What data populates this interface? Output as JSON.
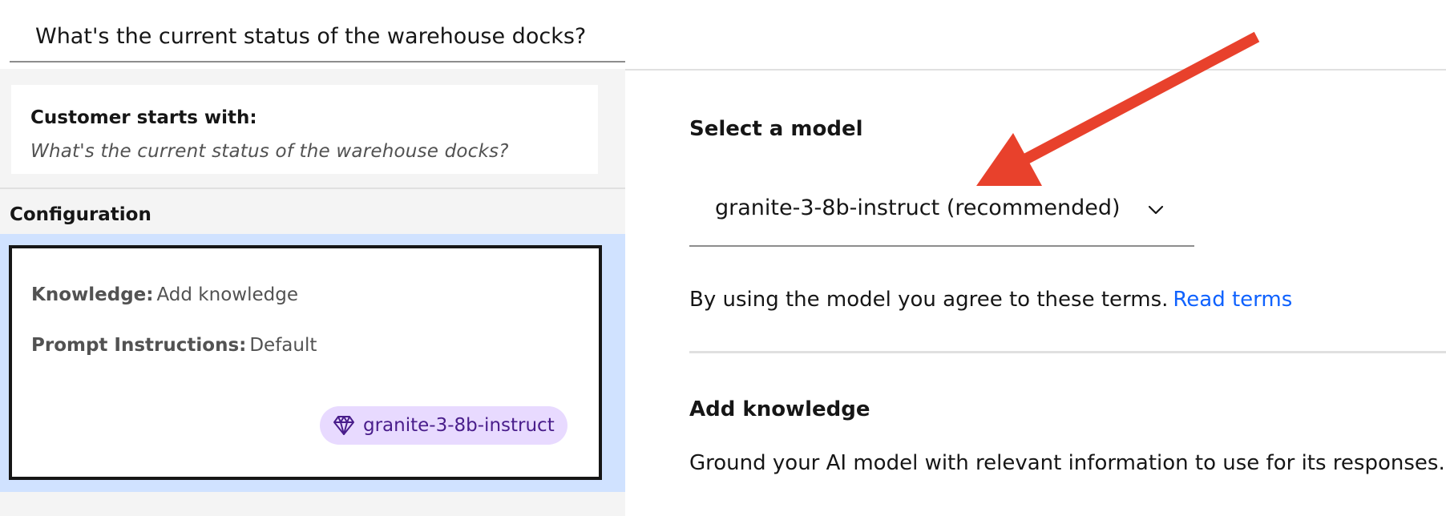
{
  "query": {
    "value": "What's the current status of the warehouse docks?"
  },
  "start_card": {
    "title": "Customer starts with:",
    "text": "What's the current status of the warehouse docks?"
  },
  "configuration": {
    "heading": "Configuration",
    "knowledge_key": "Knowledge:",
    "knowledge_value": "Add knowledge",
    "prompt_key": "Prompt Instructions:",
    "prompt_value": "Default",
    "model_tag": "granite-3-8b-instruct",
    "model_tag_icon": "diamond-icon",
    "selected_color": "#d0e2ff",
    "tag_bg": "#e8daff",
    "tag_fg": "#491d8b"
  },
  "model_select": {
    "label": "Select a model",
    "value": "granite-3-8b-instruct (recommended)",
    "icon": "chevron-down-icon"
  },
  "terms": {
    "text": "By using the model you agree to these terms.",
    "link": "Read terms",
    "link_color": "#0f62fe"
  },
  "knowledge": {
    "heading": "Add knowledge",
    "description": "Ground your AI model with relevant information to use for its responses."
  },
  "annotation": {
    "arrow_color": "#e8412c"
  }
}
